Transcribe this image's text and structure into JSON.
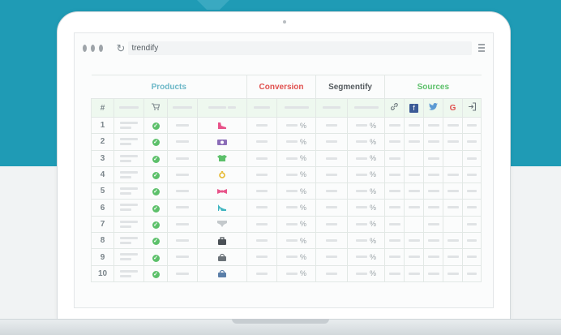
{
  "browser": {
    "url": "trendify"
  },
  "table": {
    "groups": {
      "products": "Products",
      "conversion": "Conversion",
      "segmentify": "Segmentify",
      "sources": "Sources"
    },
    "colors": {
      "products": "#6bb7c7",
      "conversion": "#e0504e",
      "segmentify": "#555b5f",
      "sources": "#5cc06a",
      "product_icon": "#e8548a"
    },
    "num_header": "#",
    "sources_icons": [
      "link-icon",
      "facebook-icon",
      "twitter-icon",
      "google-icon",
      "signin-icon"
    ],
    "google_letter": "G",
    "facebook_letter": "f",
    "percent": "%",
    "check_mark": "✓",
    "rows": [
      {
        "num": "1",
        "icon": "shoe-icon"
      },
      {
        "num": "2",
        "icon": "camera-icon"
      },
      {
        "num": "3",
        "icon": "shirt-icon"
      },
      {
        "num": "4",
        "icon": "ring-icon"
      },
      {
        "num": "5",
        "icon": "bowtie-icon"
      },
      {
        "num": "6",
        "icon": "heel-icon"
      },
      {
        "num": "7",
        "icon": "underwear-icon"
      },
      {
        "num": "8",
        "icon": "bag-icon"
      },
      {
        "num": "9",
        "icon": "handbag-icon"
      },
      {
        "num": "10",
        "icon": "purse-icon"
      }
    ]
  }
}
